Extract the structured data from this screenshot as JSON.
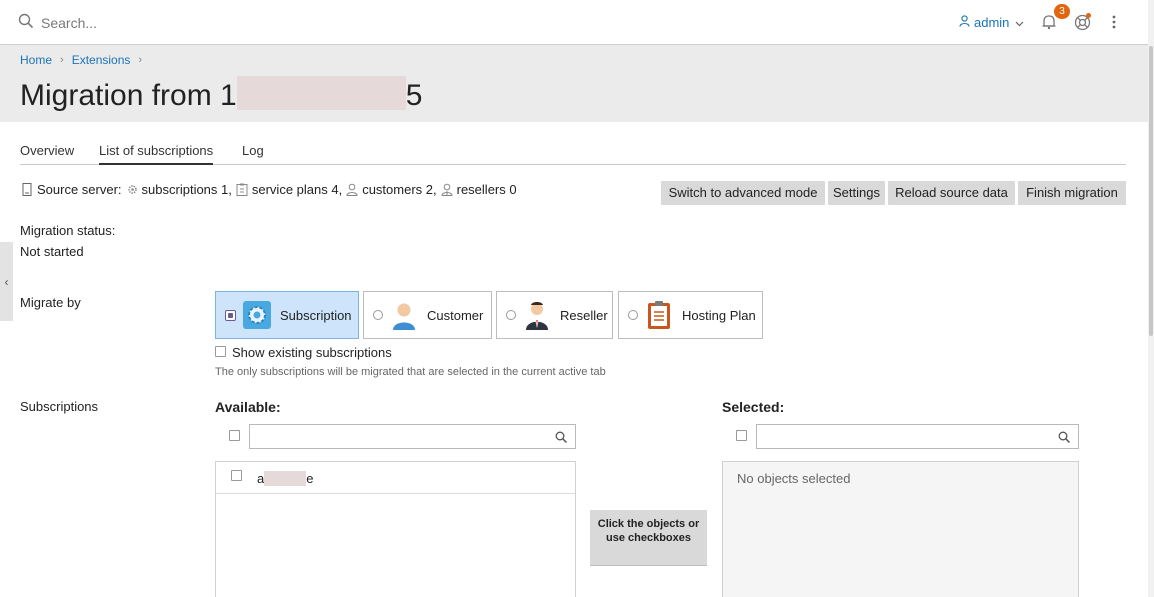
{
  "topbar": {
    "search_placeholder": "Search...",
    "user_label": "admin",
    "notification_count": "3"
  },
  "breadcrumb": [
    "Home",
    "Extensions"
  ],
  "page": {
    "title_start": "Migration from 1",
    "title_end": "5"
  },
  "tabs": [
    {
      "label": "Overview",
      "active": false
    },
    {
      "label": "List of subscriptions",
      "active": true
    },
    {
      "label": "Log",
      "active": false
    }
  ],
  "source": {
    "label": "Source server:",
    "subscriptions": "subscriptions 1,",
    "plans": "service plans 4,",
    "customers": "customers 2,",
    "resellers": "resellers 0"
  },
  "toolbar": {
    "advanced": "Switch to advanced mode",
    "settings": "Settings",
    "reload": "Reload source data",
    "finish": "Finish migration"
  },
  "status": {
    "label": "Migration status:",
    "value": "Not started"
  },
  "migrate_by": {
    "label": "Migrate by",
    "options": [
      "Subscription",
      "Customer",
      "Reseller",
      "Hosting Plan"
    ],
    "selected": "Subscription"
  },
  "show_existing": "Show existing subscriptions",
  "hint": "The only subscriptions will be migrated that are selected in the current active tab",
  "subscriptions_label": "Subscriptions",
  "available": {
    "title": "Available:",
    "item_start": "a",
    "item_end": "e"
  },
  "selected": {
    "title": "Selected:",
    "empty": "No objects selected"
  },
  "mid_button": "Click the objects or use checkboxes",
  "colors": {
    "link": "#1a73b8",
    "badge": "#e2650f",
    "selected_option_bg": "#cde4fa",
    "button_bg": "#d9d9d9"
  }
}
